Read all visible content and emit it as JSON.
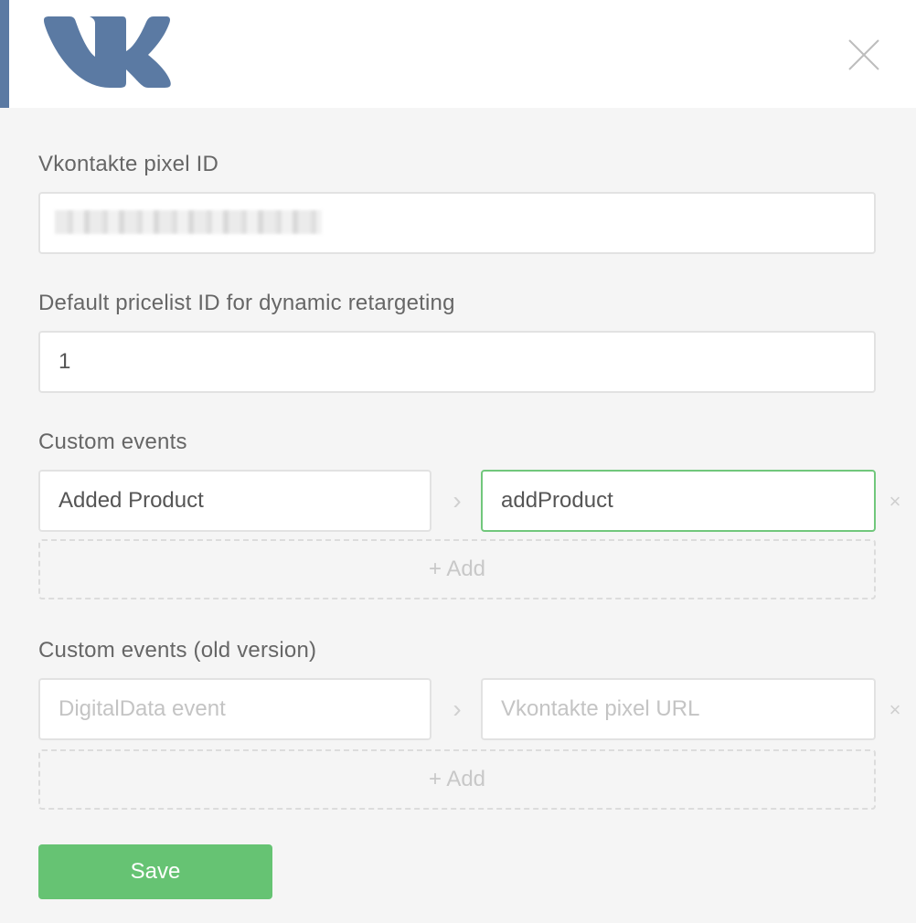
{
  "header": {
    "logo_icon": "vk-logo-icon",
    "close_icon": "close-icon",
    "accent_color": "#5b7aa3"
  },
  "pixel_id": {
    "label": "Vkontakte pixel ID",
    "value": ""
  },
  "pricelist": {
    "label": "Default pricelist ID for dynamic retargeting",
    "value": "1"
  },
  "custom_events": {
    "label": "Custom events",
    "rows": [
      {
        "source": "Added Product",
        "target": "addProduct"
      }
    ],
    "arrow_icon": "chevron-right-icon",
    "remove_icon": "remove-icon",
    "add_label": "+ Add"
  },
  "custom_events_old": {
    "label": "Custom events (old version)",
    "source_placeholder": "DigitalData event",
    "target_placeholder": "Vkontakte pixel URL",
    "add_label": "+ Add"
  },
  "save_label": "Save",
  "colors": {
    "save_button": "#66c373",
    "active_border": "#71c77c"
  }
}
